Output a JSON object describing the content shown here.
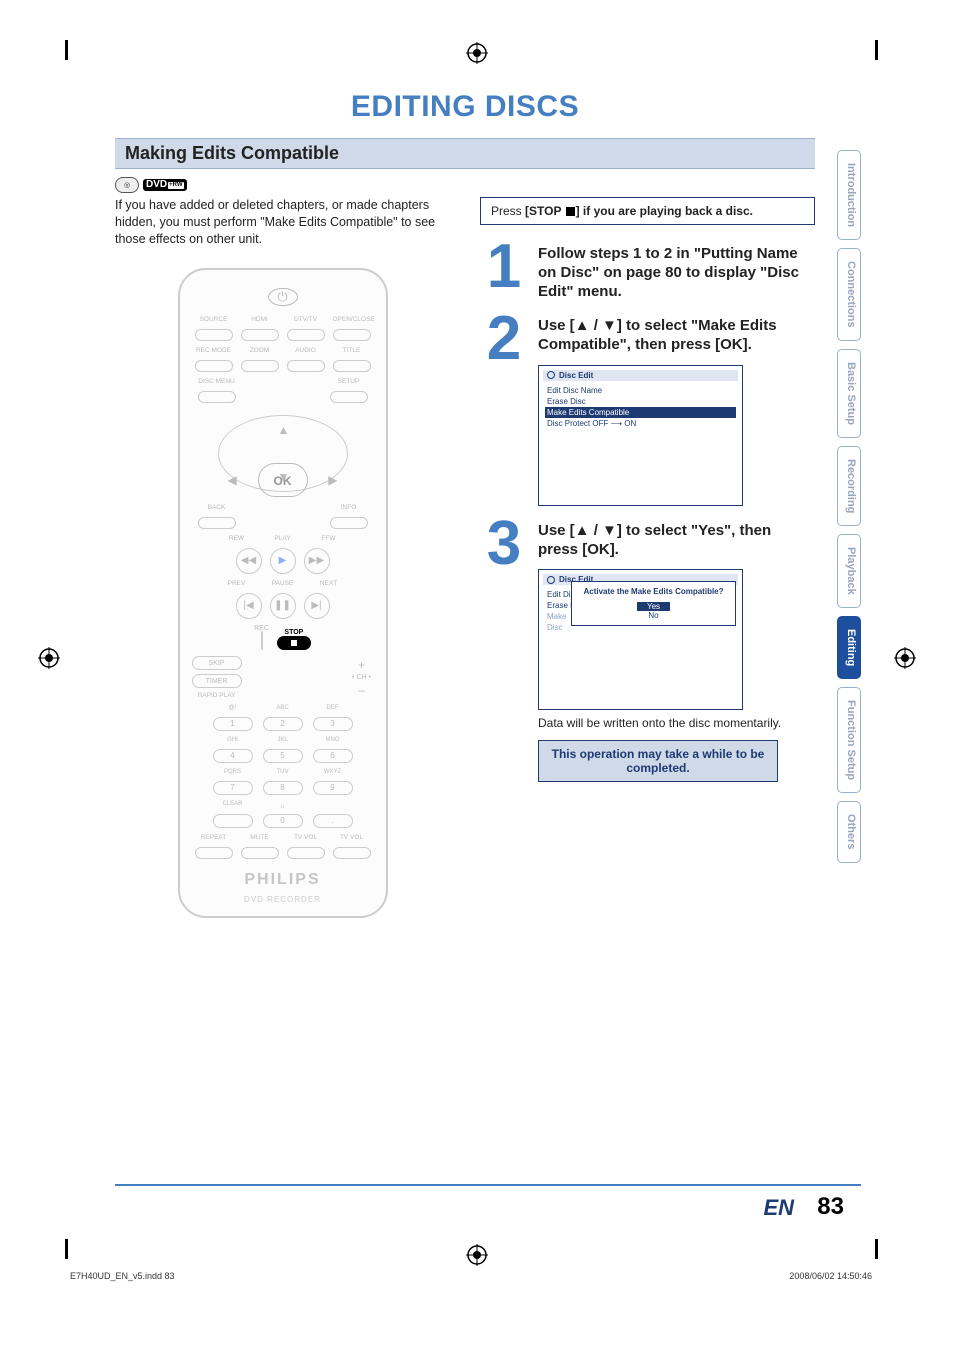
{
  "page": {
    "title": "EDITING DISCS",
    "section": "Making Edits Compatible",
    "lang_code": "EN",
    "number": "83",
    "job_line_left": "E7H40UD_EN_v5.indd   83",
    "job_line_right": "2008/06/02   14:50:46"
  },
  "badge": {
    "disc_type": "DVD",
    "sub": "+RW"
  },
  "intro": "If you have added or deleted chapters, or made chapters hidden, you must perform \"Make Edits Compatible\" to see those effects on other unit.",
  "press_box": {
    "prefix": "Press ",
    "bold": "[STOP ",
    "suffix": "] if you are playing back a disc."
  },
  "steps": [
    {
      "num": "1",
      "text": "Follow steps 1 to 2 in \"Putting Name on Disc\" on page 80 to display \"Disc Edit\" menu."
    },
    {
      "num": "2",
      "text": "Use [▲ / ▼] to select \"Make Edits Compatible\", then press [OK]."
    },
    {
      "num": "3",
      "text": "Use [▲ / ▼] to select \"Yes\", then press [OK].",
      "sub": "Data will be written onto the disc momentarily."
    }
  ],
  "osd": {
    "title": "Disc Edit",
    "items": [
      "Edit Disc Name",
      "Erase Disc",
      "Make Edits Compatible",
      "Disc Protect OFF ⟶ ON"
    ],
    "dialog_q": "Activate the Make Edits Compatible?",
    "yes": "Yes",
    "no": "No",
    "partial_items_step3": [
      "Edit Disc Name",
      "Erase Disc",
      "Make",
      "Disc"
    ]
  },
  "note_box": "This operation may take a while to be completed.",
  "tabs": [
    "Introduction",
    "Connections",
    "Basic Setup",
    "Recording",
    "Playback",
    "Editing",
    "Function Setup",
    "Others"
  ],
  "active_tab_index": 5,
  "remote": {
    "row1_labels": [
      "SOURCE",
      "HDMI",
      "DTV/TV",
      "OPEN/CLOSE"
    ],
    "row2_labels": [
      "REC MODE",
      "ZOOM",
      "AUDIO",
      "TITLE"
    ],
    "row3_labels_left": "DISC MENU",
    "row3_labels_right": "SETUP",
    "ok": "OK",
    "back": "BACK",
    "info": "INFO",
    "rew": "REW",
    "play": "PLAY",
    "ffw": "FFW",
    "prev": "PREV",
    "pause": "PAUSE",
    "next": "NEXT",
    "rec": "REC",
    "stop": "STOP",
    "skip": "SKIP",
    "timer": "TIMER",
    "ch": "CH",
    "rapid": "RAPID PLAY",
    "num_row1_lbl": [
      "@!",
      "ABC",
      "DEF"
    ],
    "num_row1": [
      "1",
      "2",
      "3"
    ],
    "num_row2_lbl": [
      "GHI",
      "JKL",
      "MNO"
    ],
    "num_row2": [
      "4",
      "5",
      "6"
    ],
    "num_row3_lbl": [
      "PQRS",
      "TUV",
      "WXYZ"
    ],
    "num_row3": [
      "7",
      "8",
      "9"
    ],
    "num_row4_lbl": [
      "CLEAR",
      "␣",
      ""
    ],
    "num_row4": [
      "",
      "0",
      "."
    ],
    "bottom_labels": [
      "REPEAT",
      "MUTE",
      "TV VOL",
      "TV VOL"
    ],
    "brand": "PHILIPS",
    "brand_sub": "DVD RECORDER"
  }
}
